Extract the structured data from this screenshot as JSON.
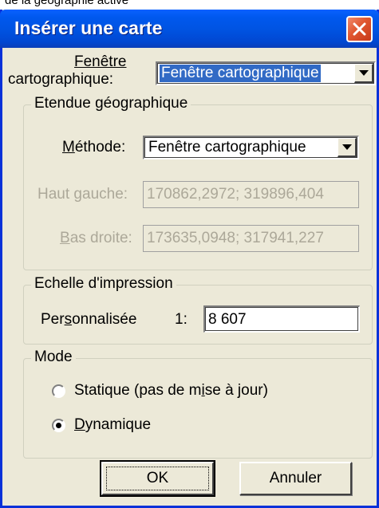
{
  "fragment_text": "de la géographie active",
  "dialog": {
    "title": "Insérer une carte",
    "map_window_label_1": "Fenêtre",
    "map_window_label_2": "cartographique:",
    "map_window_value": "Fenêtre cartographique"
  },
  "extent_group": {
    "title": "Etendue géographique",
    "method_label_pre": "",
    "method_label_mnemonic": "M",
    "method_label_post": "éthode:",
    "method_value": "Fenêtre cartographique",
    "top_left_label_pre": "Haut ",
    "top_left_label_mnemonic": "g",
    "top_left_label_post": "auche:",
    "top_left_value": "170862,2972; 319896,404",
    "bottom_right_label_pre": "",
    "bottom_right_label_mnemonic": "B",
    "bottom_right_label_post": "as droite:",
    "bottom_right_value": "173635,0948; 317941,227"
  },
  "scale_group": {
    "title": "Echelle d'impression",
    "custom_label_pre": "Per",
    "custom_label_mnemonic": "s",
    "custom_label_post": "onnalisée",
    "ratio_prefix": "1:",
    "scale_value": "8 607"
  },
  "mode_group": {
    "title": "Mode",
    "static_label_pre": "Statique (pas de m",
    "static_label_mnemonic": "i",
    "static_label_post": "se à jour)",
    "dynamic_label_mnemonic": "D",
    "dynamic_label_post": "ynamique",
    "selected": "Dynamique"
  },
  "buttons": {
    "ok": "OK",
    "cancel": "Annuler"
  },
  "colors": {
    "titlebar": "#0054E3",
    "dialog_bg": "#ECE9D8",
    "close_button": "#E0562F",
    "selection": "#316AC5",
    "disabled_text": "#ACA899"
  },
  "icons": {
    "close": "close-x-icon",
    "dropdown": "chevron-down-icon"
  }
}
